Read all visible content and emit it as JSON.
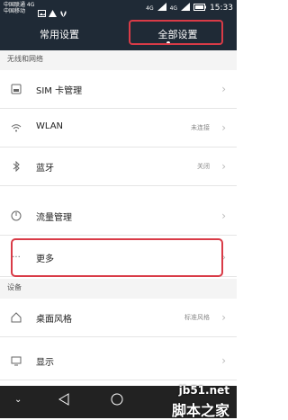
{
  "statusbar": {
    "carrier_1": "中国联通 4G",
    "carrier_2": "中国移动",
    "network_1": "4G",
    "network_2": "4G",
    "time": "15:33"
  },
  "tabs": [
    {
      "label": "常用设置"
    },
    {
      "label": "全部设置"
    }
  ],
  "sections": [
    {
      "title": "无线和网络"
    },
    {
      "title": "设备"
    }
  ],
  "rows": [
    {
      "label": "SIM 卡管理",
      "value": ""
    },
    {
      "label": "WLAN",
      "value": "未连接"
    },
    {
      "label": "蓝牙",
      "value": "关闭"
    },
    {
      "label": "流量管理",
      "value": ""
    },
    {
      "label": "更多",
      "value": ""
    },
    {
      "label": "桌面风格",
      "value": "标准风格"
    },
    {
      "label": "显示",
      "value": ""
    }
  ],
  "watermark": {
    "site": "jb51.net",
    "name": "脚本之家"
  },
  "colors": {
    "highlight": "#d93b47",
    "header_bg": "#1f2a36"
  }
}
